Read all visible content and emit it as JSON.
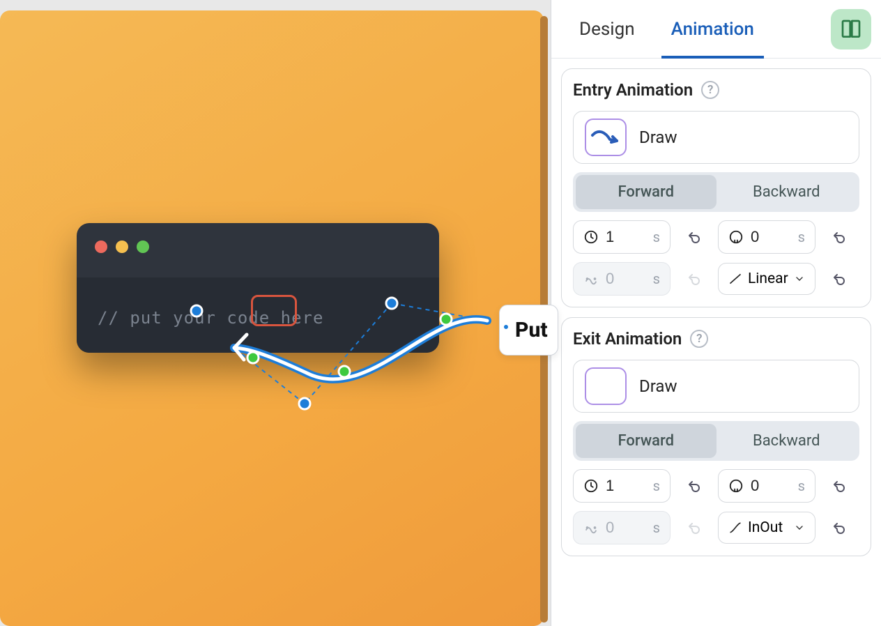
{
  "canvas": {
    "code_comment": "// put your code here",
    "float_label": "Put"
  },
  "tabs": {
    "design": "Design",
    "animation": "Animation"
  },
  "entry": {
    "title": "Entry Animation",
    "anim_name": "Draw",
    "forward": "Forward",
    "backward": "Backward",
    "duration": "1",
    "delay": "0",
    "stagger": "0",
    "unit_s": "s",
    "easing": "Linear"
  },
  "exit": {
    "title": "Exit Animation",
    "anim_name": "Draw",
    "forward": "Forward",
    "backward": "Backward",
    "duration": "1",
    "delay": "0",
    "stagger": "0",
    "unit_s": "s",
    "easing": "InOut"
  }
}
